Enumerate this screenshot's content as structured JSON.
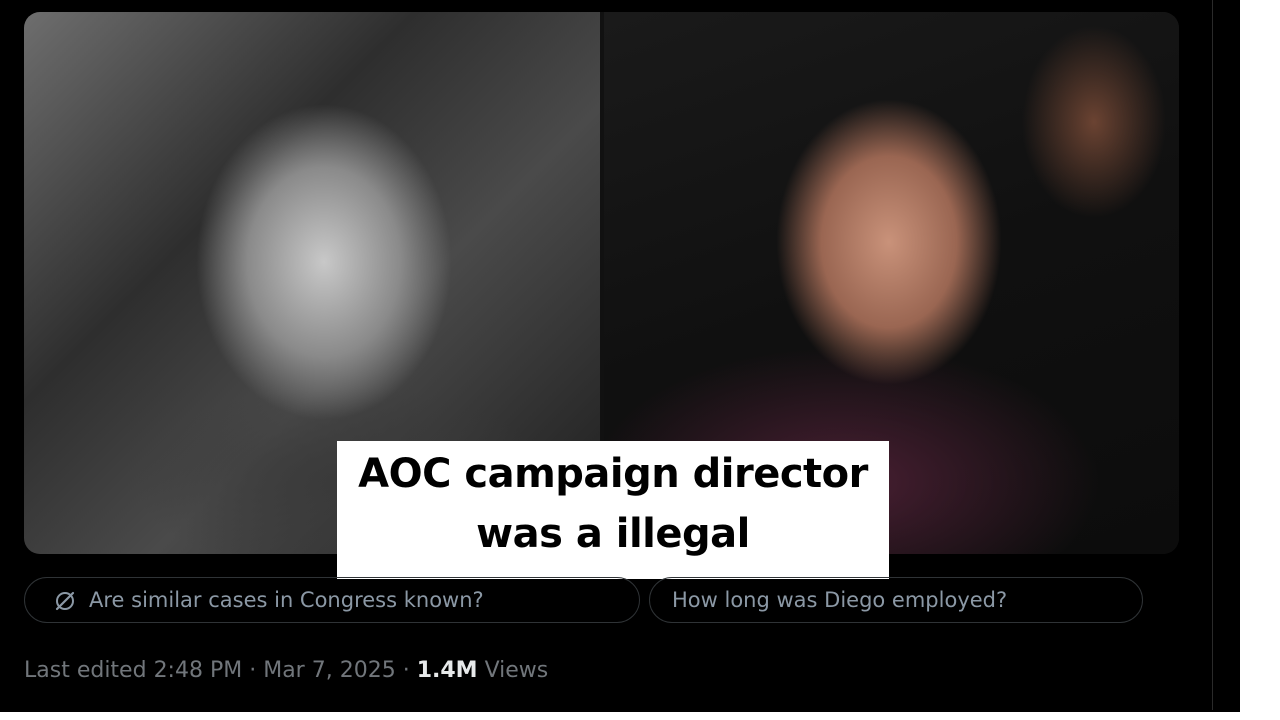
{
  "post": {
    "caption_line1": "AOC campaign director",
    "caption_line2": "was a illegal",
    "suggestions": [
      {
        "label": "Are similar cases in Congress known?",
        "icon": "grok-slash-icon"
      },
      {
        "label": "How long was Diego employed?"
      }
    ],
    "meta": {
      "prefix": "Last edited",
      "time": "2:48 PM",
      "separator": "·",
      "date": "Mar 7, 2025",
      "views_count": "1.4M",
      "views_label": "Views"
    }
  },
  "colors": {
    "background": "#000000",
    "chip_border": "#2f3336",
    "chip_text": "#8b98a5",
    "meta_text": "#71767b",
    "views_highlight": "#e7e9ea"
  }
}
